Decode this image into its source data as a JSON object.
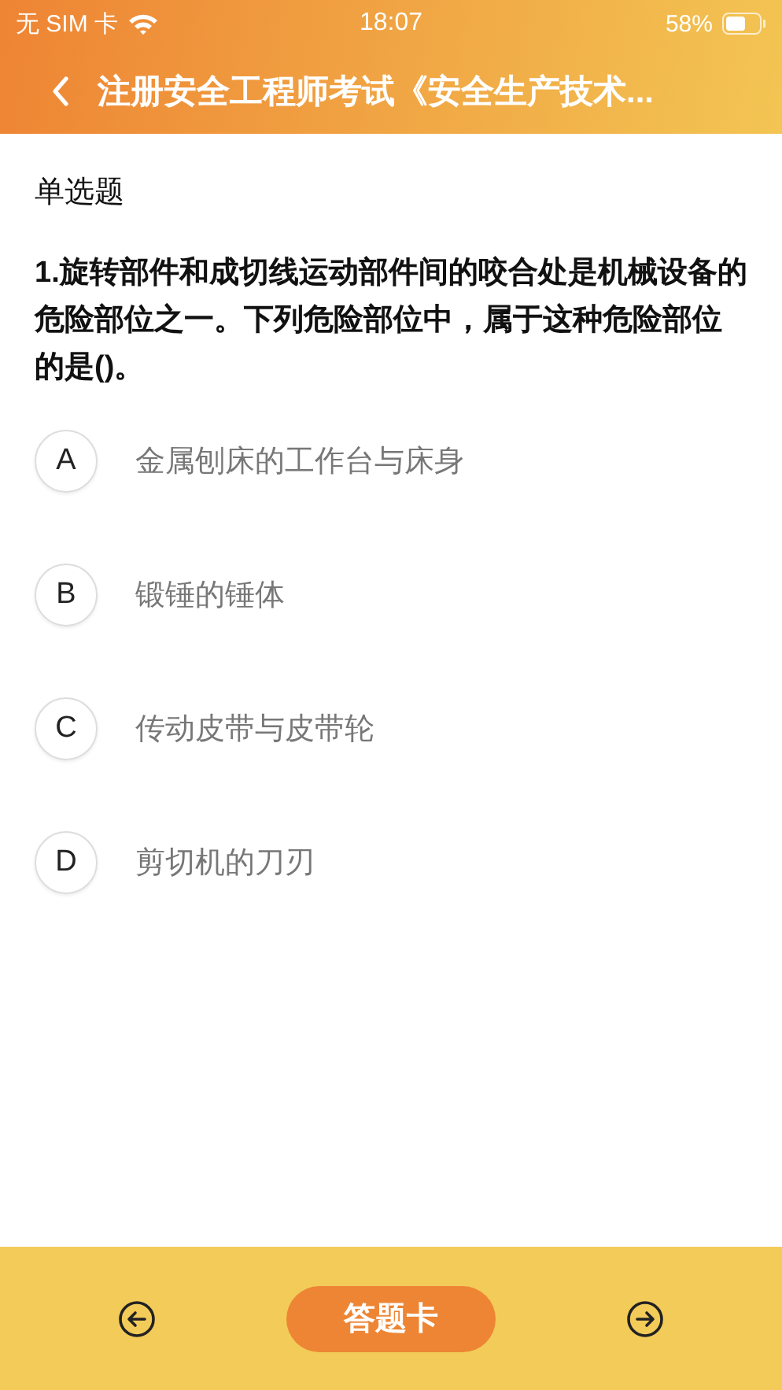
{
  "status_bar": {
    "carrier": "无 SIM 卡",
    "time": "18:07",
    "battery": "58%"
  },
  "nav": {
    "title": "注册安全工程师考试《安全生产技术..."
  },
  "question": {
    "type": "单选题",
    "text": "1.旋转部件和成切线运动部件间的咬合处是机械设备的危险部位之一。下列危险部位中，属于这种危险部位的是()。"
  },
  "options": [
    {
      "letter": "A",
      "text": "金属刨床的工作台与床身"
    },
    {
      "letter": "B",
      "text": "锻锤的锤体"
    },
    {
      "letter": "C",
      "text": "传动皮带与皮带轮"
    },
    {
      "letter": "D",
      "text": "剪切机的刀刃"
    }
  ],
  "footer": {
    "answer_card": "答题卡"
  }
}
